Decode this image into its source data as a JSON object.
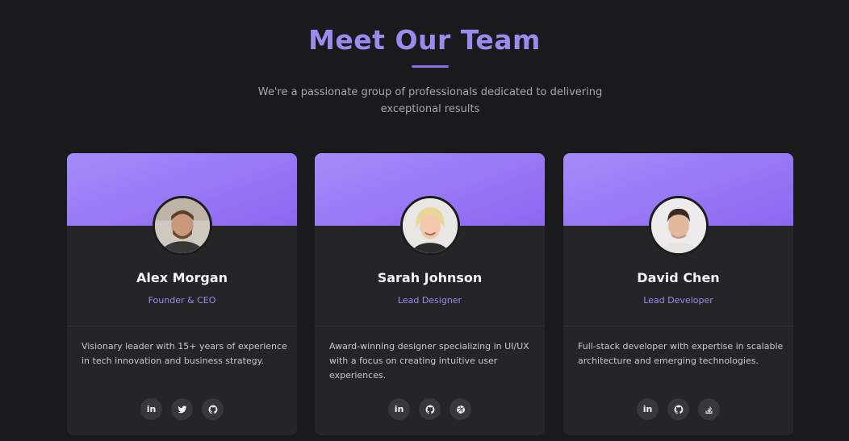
{
  "header": {
    "title": "Meet Our Team",
    "subtitle": "We're a passionate group of professionals dedicated to delivering exceptional results"
  },
  "colors": {
    "accent": "#9d8aee",
    "banner_start": "#a58cf9",
    "banner_end": "#8c67f2",
    "background": "#1a191b",
    "card": "#252427"
  },
  "members": [
    {
      "name": "Alex Morgan",
      "role": "Founder & CEO",
      "bio": "Visionary leader with 15+ years of experience in tech innovation and business strategy.",
      "socials": [
        "linkedin-icon",
        "twitter-icon",
        "github-icon"
      ]
    },
    {
      "name": "Sarah Johnson",
      "role": "Lead Designer",
      "bio": "Award-winning designer specializing in UI/UX with a focus on creating intuitive user experiences.",
      "socials": [
        "linkedin-icon",
        "github-icon",
        "dribbble-icon"
      ]
    },
    {
      "name": "David Chen",
      "role": "Lead Developer",
      "bio": "Full-stack developer with expertise in scalable architecture and emerging technologies.",
      "socials": [
        "linkedin-icon",
        "github-icon",
        "stackoverflow-icon"
      ]
    }
  ]
}
